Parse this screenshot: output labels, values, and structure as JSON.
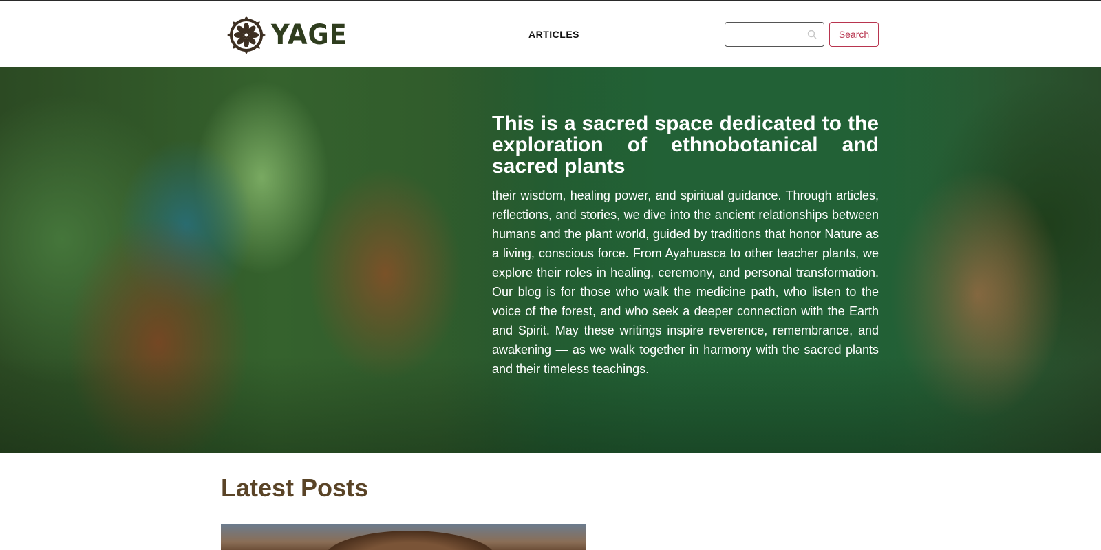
{
  "header": {
    "logo_text": "YAGE",
    "nav_articles": "ARTICLES",
    "search": {
      "placeholder": "",
      "value": "",
      "button_label": "Search"
    }
  },
  "hero": {
    "title": "This is a sacred space dedicated to the exploration of ethnobotanical and sacred plants",
    "text": "their wisdom, healing power, and spiritual guidance. Through articles, reflections, and stories, we dive into the ancient relationships between humans and the plant world, guided by traditions that honor Nature as a living, conscious force. From Ayahuasca to other teacher plants, we explore their roles in healing, ceremony, and personal transformation. Our blog is for those who walk the medicine path, who listen to the voice of the forest, and who seek a deeper connection with the Earth and Spirit. May these writings inspire reverence, remembrance, and awakening — as we walk together in harmony with the sacred plants and their timeless teachings."
  },
  "latest": {
    "title": "Latest Posts"
  },
  "colors": {
    "logo": "#2f3d1e",
    "accent": "#b8354f",
    "heading_brown": "#5a4427"
  },
  "icons": {
    "logo": "mandala-flower-icon",
    "search": "magnifier-icon"
  }
}
